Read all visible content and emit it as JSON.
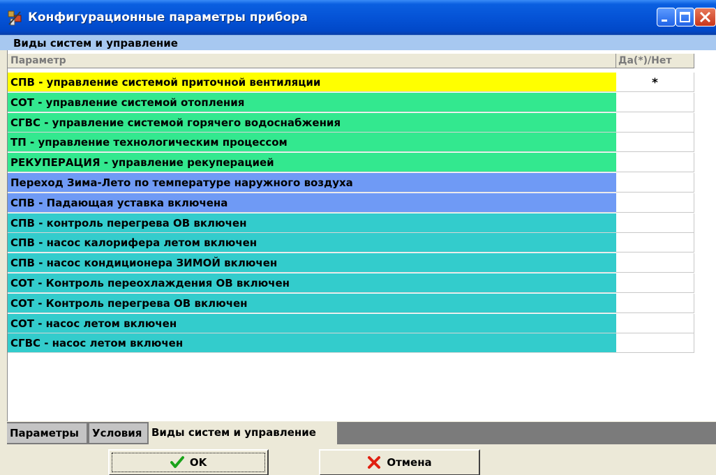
{
  "window": {
    "title": "Конфигурационные параметры прибора"
  },
  "section": {
    "title": "Виды систем и управление"
  },
  "grid": {
    "headers": {
      "param": "Параметр",
      "value": "Да(*)/Нет"
    },
    "rows": [
      {
        "label": "СПВ - управление системой приточной вентиляции",
        "value": "*",
        "color": "#ffff00"
      },
      {
        "label": "СОТ - управление системой отопления",
        "value": "",
        "color": "#33e88f"
      },
      {
        "label": "СГВС - управление системой горячего водоснабжения",
        "value": "",
        "color": "#33e88f"
      },
      {
        "label": "ТП - управление технологическим процессом",
        "value": "",
        "color": "#33e88f"
      },
      {
        "label": "РЕКУПЕРАЦИЯ - управление рекуперацией",
        "value": "",
        "color": "#33e88f"
      },
      {
        "label": "Переход Зима-Лето по температуре наружного воздуха",
        "value": "",
        "color": "#6f9af5"
      },
      {
        "label": "СПВ - Падающая уставка включена",
        "value": "",
        "color": "#6f9af5"
      },
      {
        "label": "СПВ - контроль перегрева ОВ включен",
        "value": "",
        "color": "#33cccc"
      },
      {
        "label": "СПВ - насос калорифера летом включен",
        "value": "",
        "color": "#33cccc"
      },
      {
        "label": "СПВ - насос кондиционера ЗИМОЙ включен",
        "value": "",
        "color": "#33cccc"
      },
      {
        "label": "СОТ - Контроль переохлаждения ОВ включен",
        "value": "",
        "color": "#33cccc"
      },
      {
        "label": "СОТ - Контроль перегрева ОВ включен",
        "value": "",
        "color": "#33cccc"
      },
      {
        "label": "СОТ - насос летом включен",
        "value": "",
        "color": "#33cccc"
      },
      {
        "label": "СГВС - насос летом включен",
        "value": "",
        "color": "#33cccc"
      }
    ]
  },
  "tabs": [
    {
      "label": "Параметры"
    },
    {
      "label": "Условия"
    },
    {
      "label": "Виды систем и управление"
    }
  ],
  "buttons": {
    "ok": "OK",
    "cancel": "Отмена"
  },
  "icons": {
    "app": "app-config-icon",
    "ok": "check-icon",
    "cancel": "cross-icon"
  }
}
